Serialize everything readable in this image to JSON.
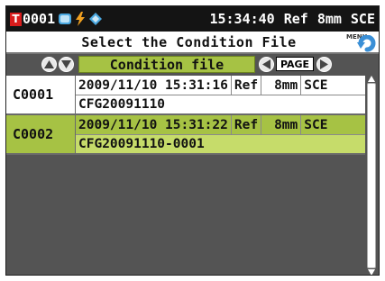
{
  "status": {
    "file_number": "0001",
    "time": "15:34:40",
    "mode": "Ref",
    "aperture": "8mm",
    "specular": "SCE"
  },
  "title": {
    "text": "Select the Condition File",
    "menu_label": "MENU"
  },
  "header": {
    "condition_label": "Condition file",
    "page_label": "PAGE"
  },
  "rows": [
    {
      "num": "C0001",
      "datetime": "2009/11/10 15:31:16",
      "mode": "Ref",
      "aperture": "8mm",
      "specular": "SCE",
      "filename": "CFG20091110"
    },
    {
      "num": "C0002",
      "datetime": "2009/11/10 15:31:22",
      "mode": "Ref",
      "aperture": "8mm",
      "specular": "SCE",
      "filename": "CFG20091110-0001"
    }
  ],
  "colors": {
    "selected_green": "#a6c244",
    "selected_green_light": "#c6dc6a",
    "badge_red": "#d91c1c"
  }
}
